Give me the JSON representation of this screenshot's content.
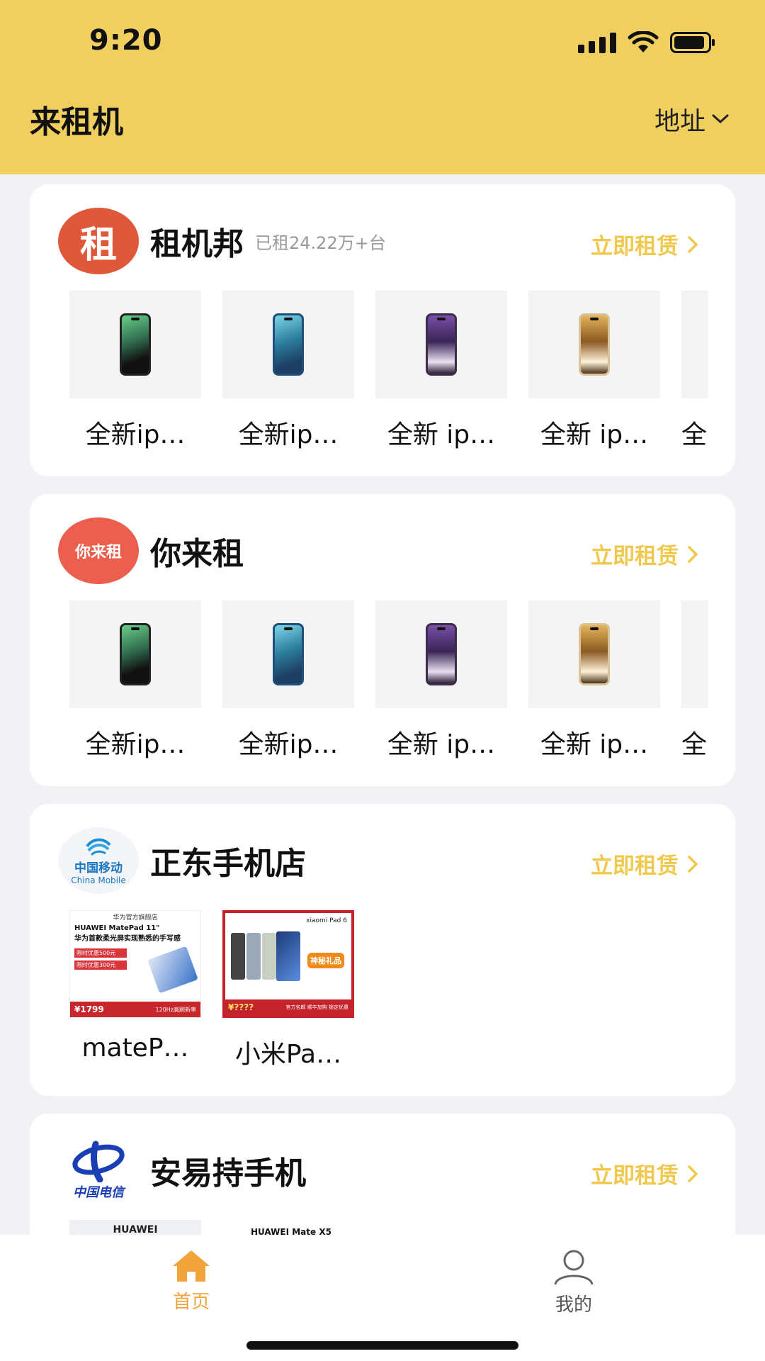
{
  "status_bar": {
    "time": "9:20"
  },
  "header": {
    "title": "来租机",
    "address_label": "地址"
  },
  "colors": {
    "header_bg": "#f0cf5e",
    "accent": "#f0c84e",
    "tab_active": "#f0a43a"
  },
  "stores": [
    {
      "name": "租机邦",
      "logo_text": "租",
      "subtitle": "已租24.22万+台",
      "rent_label": "立即租赁",
      "products": [
        {
          "name": "全新ip…",
          "image": "iphone-green-icon"
        },
        {
          "name": "全新ip…",
          "image": "iphone-blue-icon"
        },
        {
          "name": "全新 ip…",
          "image": "iphone-purple-icon"
        },
        {
          "name": "全新 ip…",
          "image": "iphone-gold-icon"
        },
        {
          "name": "全",
          "image": "product-partial"
        }
      ]
    },
    {
      "name": "你来租",
      "logo_text": "你来租",
      "subtitle": "",
      "rent_label": "立即租赁",
      "products": [
        {
          "name": "全新ip…",
          "image": "iphone-green-icon"
        },
        {
          "name": "全新ip…",
          "image": "iphone-blue-icon"
        },
        {
          "name": "全新 ip…",
          "image": "iphone-purple-icon"
        },
        {
          "name": "全新 ip…",
          "image": "iphone-gold-icon"
        },
        {
          "name": "全",
          "image": "product-partial"
        }
      ]
    },
    {
      "name": "正东手机店",
      "logo_text": "中国移动",
      "logo_subtext": "China Mobile",
      "subtitle": "",
      "rent_label": "立即租赁",
      "products": [
        {
          "name": "mateP…",
          "image": "huawei-matepad-ad",
          "ad_top": "华为官方旗舰店",
          "ad_title": "HUAWEI MatePad 11\"",
          "ad_sub": "华为首款柔光屏实现熟悉的手写感",
          "ad_tag1": "限时优惠500元",
          "ad_tag2": "限时优惠300元",
          "ad_price": "¥1799",
          "ad_foot": "120Hz高刷新率"
        },
        {
          "name": "小米Pa…",
          "image": "xiaomi-pad-ad",
          "ad_top": "xiaomi Pad 6",
          "ad_badge": "神秘礼品",
          "ad_price": "¥????",
          "ad_foot": "官方包邮 顺丰加购 锁定优惠"
        }
      ]
    },
    {
      "name": "安易持手机",
      "logo_text": "中国电信",
      "subtitle": "",
      "rent_label": "立即租赁",
      "products": [
        {
          "name": "",
          "image": "huawei-ad",
          "ad_top": "HUAWEI"
        },
        {
          "name": "",
          "image": "huawei-mate-x5-ad",
          "ad_top": "HUAWEI Mate X5"
        }
      ]
    }
  ],
  "tabbar": {
    "home_label": "首页",
    "mine_label": "我的"
  }
}
